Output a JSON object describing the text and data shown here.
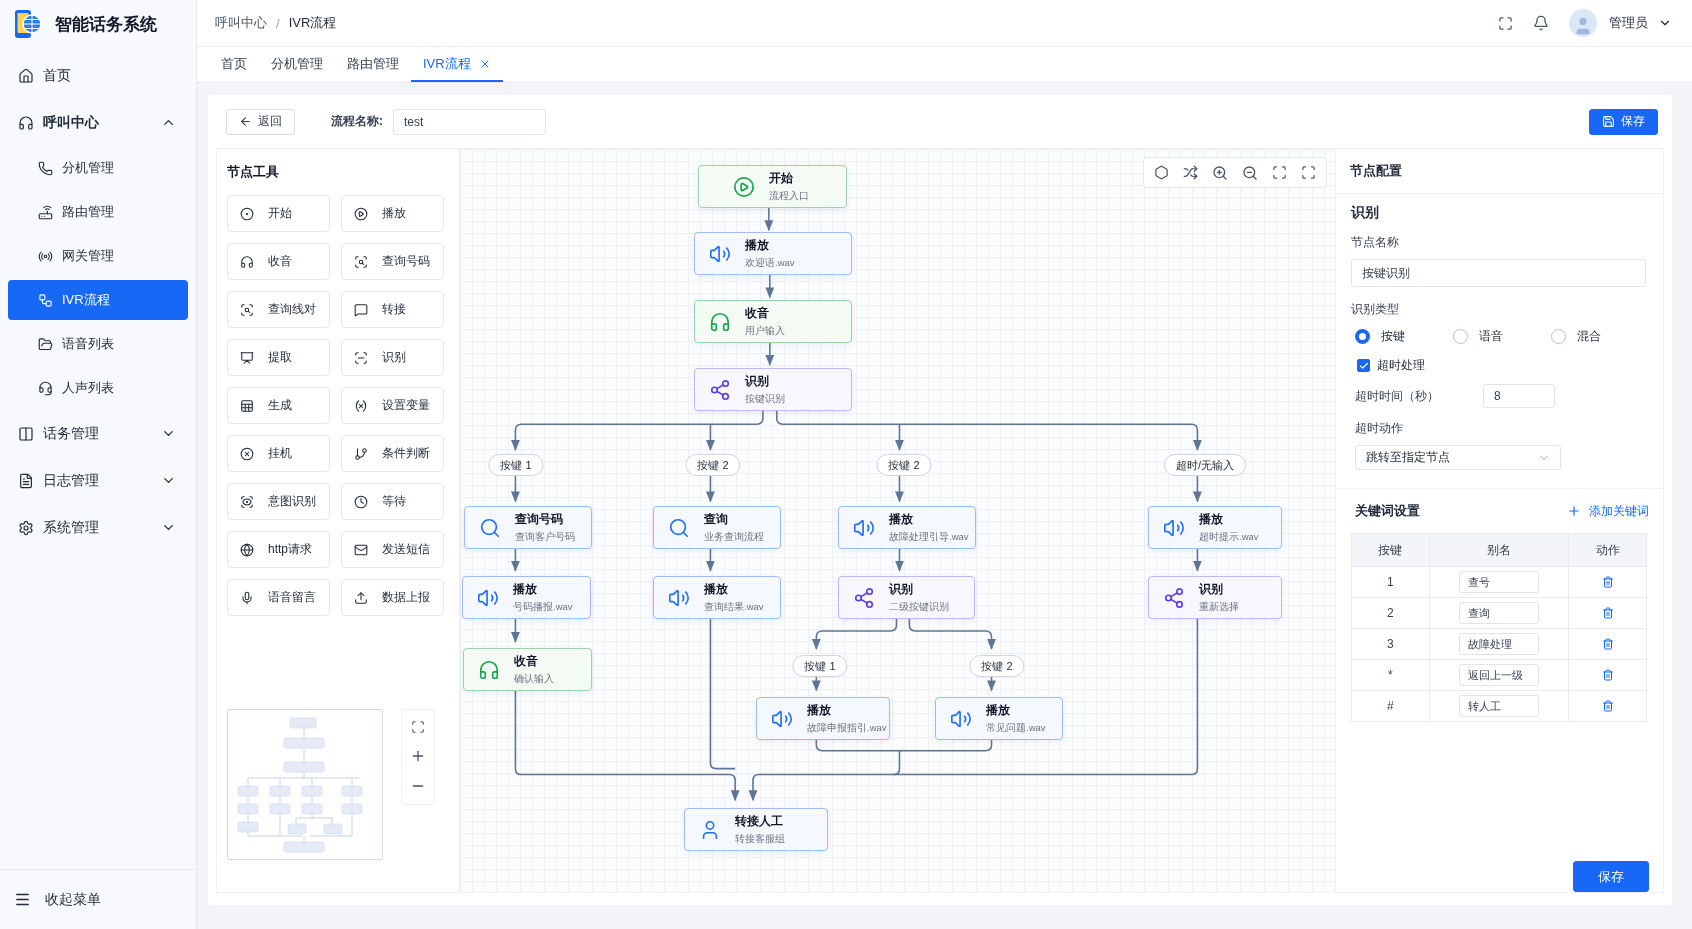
{
  "app": {
    "title": "智能话务系统"
  },
  "sidebar": {
    "items": [
      {
        "label": "首页",
        "selected": false
      },
      {
        "label": "呼叫中心",
        "expanded": true,
        "selected": false,
        "children": [
          {
            "label": "分机管理",
            "selected": false
          },
          {
            "label": "路由管理",
            "selected": false
          },
          {
            "label": "网关管理",
            "selected": false
          },
          {
            "label": "IVR流程",
            "selected": true
          },
          {
            "label": "语音列表",
            "selected": false
          },
          {
            "label": "人声列表",
            "selected": false
          }
        ]
      },
      {
        "label": "话务管理",
        "expanded": false,
        "selected": false
      },
      {
        "label": "日志管理",
        "expanded": false,
        "selected": false
      },
      {
        "label": "系统管理",
        "expanded": false,
        "selected": false
      }
    ],
    "collapse_label": "收起菜单"
  },
  "header": {
    "breadcrumb": [
      "呼叫中心",
      "IVR流程"
    ],
    "separator": "/",
    "user": "管理员"
  },
  "tabs": [
    {
      "label": "首页",
      "selected": false,
      "closable": false
    },
    {
      "label": "分机管理",
      "selected": false,
      "closable": false
    },
    {
      "label": "路由管理",
      "selected": false,
      "closable": false
    },
    {
      "label": "IVR流程",
      "selected": true,
      "closable": true
    }
  ],
  "toolbar": {
    "back": "返回",
    "flow_name_label": "流程名称:",
    "flow_name": "test",
    "save": "保存"
  },
  "tools": {
    "title": "节点工具",
    "items": [
      "开始",
      "播放",
      "收音",
      "查询号码",
      "查询线对",
      "转接",
      "提取",
      "识别",
      "生成",
      "设置变量",
      "挂机",
      "条件判断",
      "意图识别",
      "等待",
      "http请求",
      "发送短信",
      "语音留言",
      "数据上报"
    ]
  },
  "canvas": {
    "nodes": [
      {
        "kind": "start",
        "title": "开始",
        "subtitle": "流程入口"
      },
      {
        "kind": "play",
        "title": "播放",
        "subtitle": "欢迎语.wav"
      },
      {
        "kind": "record",
        "title": "收音",
        "subtitle": "用户输入"
      },
      {
        "kind": "recognize",
        "title": "识别",
        "subtitle": "按键识别"
      },
      {
        "kind": "query",
        "title": "查询号码",
        "subtitle": "查询客户号码"
      },
      {
        "kind": "query",
        "title": "查询",
        "subtitle": "业务查询流程"
      },
      {
        "kind": "play",
        "title": "播放",
        "subtitle": "故障处理引导.wav"
      },
      {
        "kind": "play",
        "title": "播放",
        "subtitle": "超时提示.wav"
      },
      {
        "kind": "play",
        "title": "播放",
        "subtitle": "号码播报.wav"
      },
      {
        "kind": "play",
        "title": "播放",
        "subtitle": "查询结果.wav"
      },
      {
        "kind": "recognize",
        "title": "识别",
        "subtitle": "二级按键识别"
      },
      {
        "kind": "recognize",
        "title": "识别",
        "subtitle": "重新选择"
      },
      {
        "kind": "record",
        "title": "收音",
        "subtitle": "确认输入"
      },
      {
        "kind": "play",
        "title": "播放",
        "subtitle": "故障申报指引.wav"
      },
      {
        "kind": "play",
        "title": "播放",
        "subtitle": "常见问题.wav"
      },
      {
        "kind": "transfer",
        "title": "转接人工",
        "subtitle": "转接客服组"
      }
    ],
    "edge_labels": [
      "按键 1",
      "按键 2",
      "按键 2",
      "超时/无输入",
      "按键 1",
      "按键 2"
    ]
  },
  "config": {
    "title": "节点配置",
    "section": "识别",
    "name_label": "节点名称",
    "name_value": "按键识别",
    "type_label": "识别类型",
    "type_options": [
      {
        "label": "按键",
        "selected": true
      },
      {
        "label": "语音",
        "selected": false
      },
      {
        "label": "混合",
        "selected": false
      }
    ],
    "timeout_check": {
      "label": "超时处理",
      "checked": true
    },
    "timeout_label": "超时时间（秒）",
    "timeout_value": "8",
    "action_label": "超时动作",
    "action_value": "跳转至指定节点",
    "keywords": {
      "title": "关键词设置",
      "add": "添加关键词",
      "columns": [
        "按键",
        "别名",
        "动作"
      ],
      "rows": [
        {
          "key": "1",
          "alias": "查号"
        },
        {
          "key": "2",
          "alias": "查询"
        },
        {
          "key": "3",
          "alias": "故障处理"
        },
        {
          "key": "*",
          "alias": "返回上一级"
        },
        {
          "key": "#",
          "alias": "转人工"
        }
      ]
    },
    "save": "保存"
  }
}
